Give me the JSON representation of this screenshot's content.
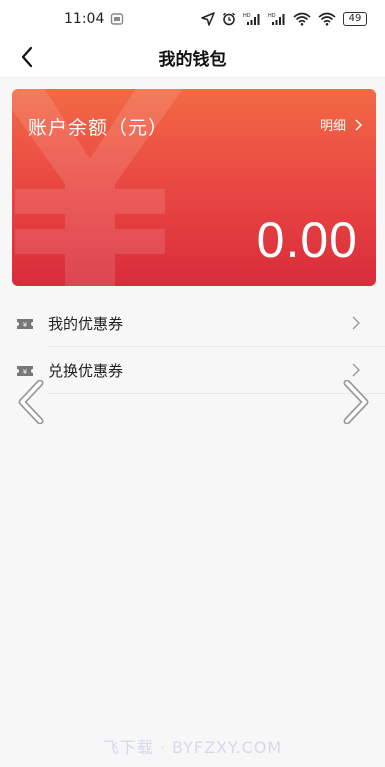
{
  "status_bar": {
    "time": "11:04",
    "battery": "49"
  },
  "header": {
    "title": "我的钱包"
  },
  "wallet_card": {
    "label": "账户余额（元）",
    "detail_link": "明细",
    "balance": "0.00",
    "colors": {
      "gradient_top": "#f26a45",
      "gradient_bottom": "#d92c3b"
    }
  },
  "menu": {
    "items": [
      {
        "label": "我的优惠券",
        "icon": "coupon-icon"
      },
      {
        "label": "兑换优惠券",
        "icon": "coupon-icon"
      }
    ]
  },
  "watermark": "飞下载 · BYFZXY.COM"
}
